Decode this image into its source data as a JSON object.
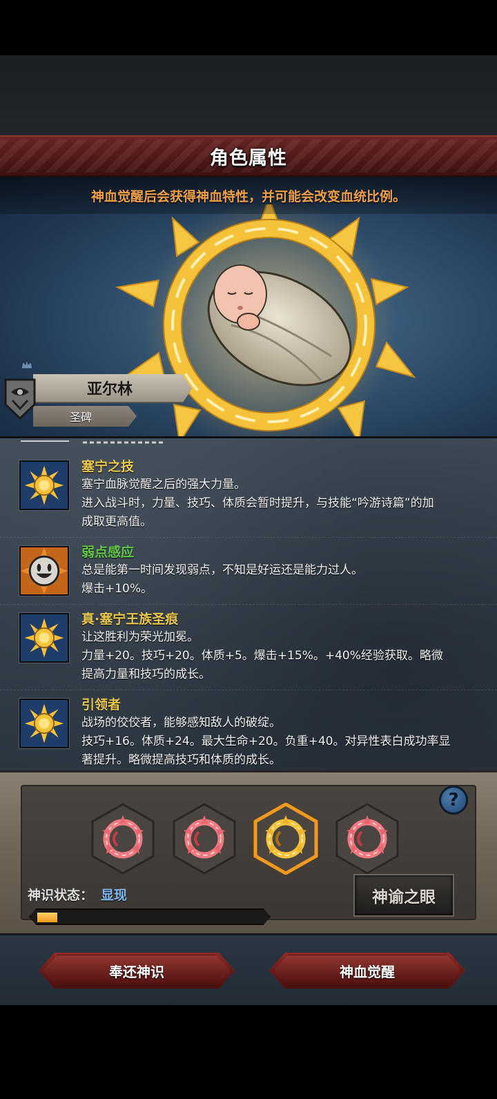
{
  "header": {
    "title": "角色属性"
  },
  "hero": {
    "tip": "神血觉醒后会获得神血特性，并可能会改变血统比例。",
    "character_name": "亚尔林",
    "character_title": "圣碑"
  },
  "traits": [
    {
      "name": "塞宁之技",
      "icon": "sun-emblem-icon",
      "name_color": "#e8c74a",
      "lines": [
        "塞宁血脉觉醒之后的强大力量。",
        "进入战斗时，力量、技巧、体质会暂时提升，与技能“吟游诗篇”的加",
        "成取更高值。"
      ]
    },
    {
      "name": "弱点感应",
      "icon": "smiley-face-icon",
      "name_color": "#63c746",
      "lines": [
        "总是能第一时间发现弱点，不知是好运还是能力过人。",
        "爆击+10%。"
      ]
    },
    {
      "name": "真·塞宁王族圣痕",
      "icon": "sun-emblem-icon",
      "name_color": "#e8c74a",
      "lines": [
        "让这胜利为荣光加冕。",
        "力量+20。技巧+20。体质+5。爆击+15%。+40%经验获取。略微",
        "提高力量和技巧的成长。"
      ]
    },
    {
      "name": "引领者",
      "icon": "sun-emblem-icon",
      "name_color": "#e8c74a",
      "lines": [
        "战场的佼佼者，能够感知敌人的破绽。",
        "技巧+16。体质+24。最大生命+20。负重+40。对异性表白成功率显",
        "著提升。略微提高技巧和体质的成长。"
      ]
    }
  ],
  "divine": {
    "slots": [
      {
        "icon": "red-sun-ring-icon",
        "active": false
      },
      {
        "icon": "red-sun-ring-icon",
        "active": false
      },
      {
        "icon": "gold-sun-ring-icon",
        "active": true
      },
      {
        "icon": "red-sun-ring-icon",
        "active": false
      }
    ],
    "help_label": "?",
    "status_label": "神识状态：",
    "status_value": "显现",
    "progress_fraction": 0.09,
    "oracle_button": "神谕之眼"
  },
  "footer": {
    "return_button": "奉还神识",
    "awaken_button": "神血觉醒"
  },
  "colors": {
    "accent_gold": "#e8c74a",
    "accent_green": "#63c746",
    "tip_orange": "#f0a048",
    "button_red": "#641815"
  }
}
